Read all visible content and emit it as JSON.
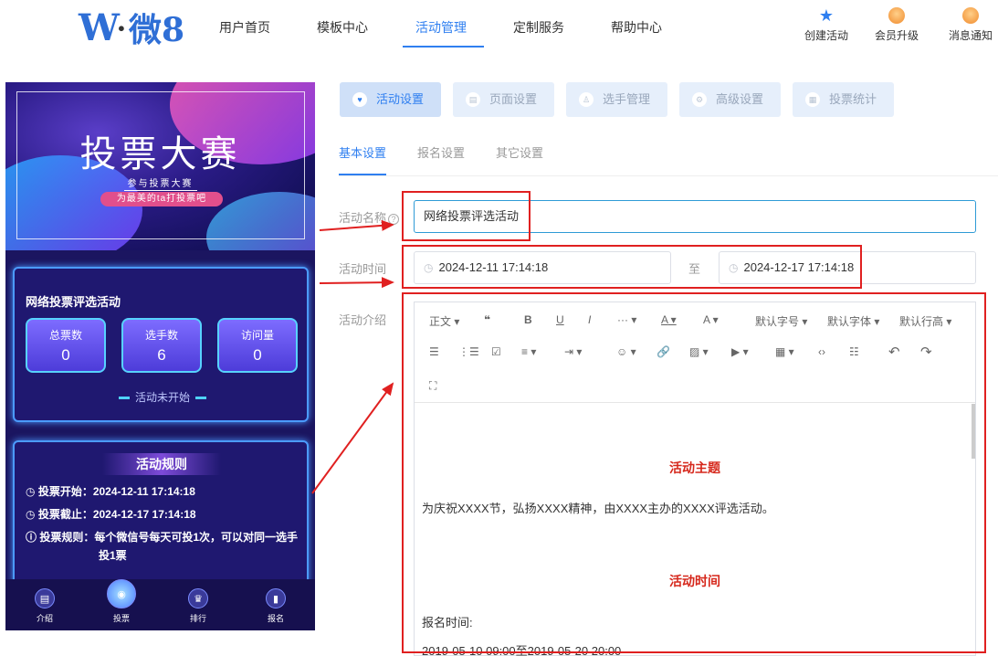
{
  "logo": {
    "mark": "W",
    "text": "微8"
  },
  "nav": {
    "items": [
      "用户首页",
      "模板中心",
      "活动管理",
      "定制服务",
      "帮助中心"
    ],
    "active": "活动管理"
  },
  "top_actions": [
    {
      "label": "创建活动",
      "icon": "create-activity-icon"
    },
    {
      "label": "会员升级",
      "icon": "member-upgrade-icon"
    },
    {
      "label": "消息通知",
      "icon": "notification-icon"
    }
  ],
  "phone": {
    "banner": {
      "title": "投票大赛",
      "subtitle": "参与投票大赛",
      "pill": "为最美的ta打投票吧"
    },
    "stats": {
      "title": "网络投票评选活动",
      "items": [
        {
          "label": "总票数",
          "value": "0"
        },
        {
          "label": "选手数",
          "value": "6"
        },
        {
          "label": "访问量",
          "value": "0"
        }
      ],
      "status": "活动未开始"
    },
    "rules": {
      "title": "活动规则",
      "lines": [
        "投票开始：2024-12-11 17:14:18",
        "投票截止：2024-12-17 17:14:18",
        "投票规则：每个微信号每天可投1次，可以对同一选手",
        "投1票"
      ]
    },
    "tabbar": [
      "介绍",
      "投票",
      "排行",
      "报名"
    ]
  },
  "tabs": {
    "main": [
      "活动设置",
      "页面设置",
      "选手管理",
      "高级设置",
      "投票统计"
    ],
    "sub": [
      "基本设置",
      "报名设置",
      "其它设置"
    ]
  },
  "form": {
    "name_label": "活动名称",
    "name_value": "网络投票评选活动",
    "time_label": "活动时间",
    "start": "2024-12-11 17:14:18",
    "to": "至",
    "end": "2024-12-17 17:14:18",
    "intro_label": "活动介绍"
  },
  "toolbar": {
    "row1": [
      "正文",
      "❝",
      "B",
      "U",
      "I",
      "···",
      "A",
      "A",
      "默认字号",
      "默认字体",
      "默认行高"
    ],
    "row2": [
      "☰",
      "⋮☰",
      "☑",
      "≡",
      "⇥",
      "☺",
      "🔗",
      "▨",
      "▶",
      "▦",
      "‹›",
      "☷",
      "↶",
      "↷"
    ],
    "row3": [
      "⛶"
    ]
  },
  "editor": {
    "h1": "活动主题",
    "p1": "为庆祝XXXX节，弘扬XXXX精神，由XXXX主办的XXXX评选活动。",
    "h2": "活动时间",
    "p2": "报名时间:",
    "p3": "2019-05-10 09:00至2019-05-20 20:00"
  },
  "colors": {
    "accent": "#2f7ff0",
    "annotation": "#e02020",
    "phone_bg": "#1b1560"
  }
}
